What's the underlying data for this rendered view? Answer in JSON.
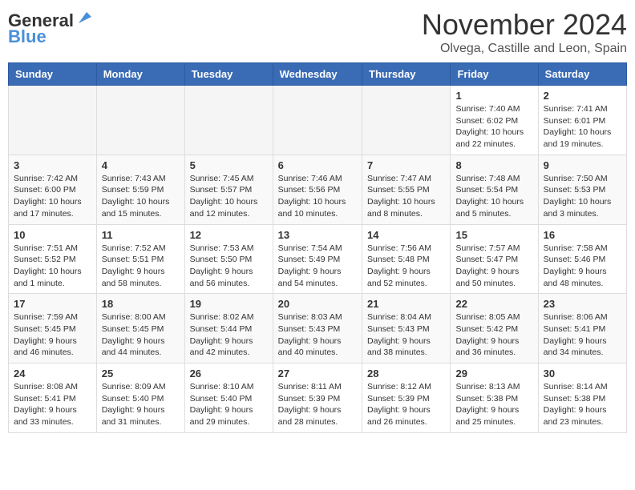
{
  "logo": {
    "line1": "General",
    "line2": "Blue"
  },
  "title": "November 2024",
  "location": "Olvega, Castille and Leon, Spain",
  "headers": [
    "Sunday",
    "Monday",
    "Tuesday",
    "Wednesday",
    "Thursday",
    "Friday",
    "Saturday"
  ],
  "weeks": [
    [
      {
        "day": "",
        "info": ""
      },
      {
        "day": "",
        "info": ""
      },
      {
        "day": "",
        "info": ""
      },
      {
        "day": "",
        "info": ""
      },
      {
        "day": "",
        "info": ""
      },
      {
        "day": "1",
        "info": "Sunrise: 7:40 AM\nSunset: 6:02 PM\nDaylight: 10 hours and 22 minutes."
      },
      {
        "day": "2",
        "info": "Sunrise: 7:41 AM\nSunset: 6:01 PM\nDaylight: 10 hours and 19 minutes."
      }
    ],
    [
      {
        "day": "3",
        "info": "Sunrise: 7:42 AM\nSunset: 6:00 PM\nDaylight: 10 hours and 17 minutes."
      },
      {
        "day": "4",
        "info": "Sunrise: 7:43 AM\nSunset: 5:59 PM\nDaylight: 10 hours and 15 minutes."
      },
      {
        "day": "5",
        "info": "Sunrise: 7:45 AM\nSunset: 5:57 PM\nDaylight: 10 hours and 12 minutes."
      },
      {
        "day": "6",
        "info": "Sunrise: 7:46 AM\nSunset: 5:56 PM\nDaylight: 10 hours and 10 minutes."
      },
      {
        "day": "7",
        "info": "Sunrise: 7:47 AM\nSunset: 5:55 PM\nDaylight: 10 hours and 8 minutes."
      },
      {
        "day": "8",
        "info": "Sunrise: 7:48 AM\nSunset: 5:54 PM\nDaylight: 10 hours and 5 minutes."
      },
      {
        "day": "9",
        "info": "Sunrise: 7:50 AM\nSunset: 5:53 PM\nDaylight: 10 hours and 3 minutes."
      }
    ],
    [
      {
        "day": "10",
        "info": "Sunrise: 7:51 AM\nSunset: 5:52 PM\nDaylight: 10 hours and 1 minute."
      },
      {
        "day": "11",
        "info": "Sunrise: 7:52 AM\nSunset: 5:51 PM\nDaylight: 9 hours and 58 minutes."
      },
      {
        "day": "12",
        "info": "Sunrise: 7:53 AM\nSunset: 5:50 PM\nDaylight: 9 hours and 56 minutes."
      },
      {
        "day": "13",
        "info": "Sunrise: 7:54 AM\nSunset: 5:49 PM\nDaylight: 9 hours and 54 minutes."
      },
      {
        "day": "14",
        "info": "Sunrise: 7:56 AM\nSunset: 5:48 PM\nDaylight: 9 hours and 52 minutes."
      },
      {
        "day": "15",
        "info": "Sunrise: 7:57 AM\nSunset: 5:47 PM\nDaylight: 9 hours and 50 minutes."
      },
      {
        "day": "16",
        "info": "Sunrise: 7:58 AM\nSunset: 5:46 PM\nDaylight: 9 hours and 48 minutes."
      }
    ],
    [
      {
        "day": "17",
        "info": "Sunrise: 7:59 AM\nSunset: 5:45 PM\nDaylight: 9 hours and 46 minutes."
      },
      {
        "day": "18",
        "info": "Sunrise: 8:00 AM\nSunset: 5:45 PM\nDaylight: 9 hours and 44 minutes."
      },
      {
        "day": "19",
        "info": "Sunrise: 8:02 AM\nSunset: 5:44 PM\nDaylight: 9 hours and 42 minutes."
      },
      {
        "day": "20",
        "info": "Sunrise: 8:03 AM\nSunset: 5:43 PM\nDaylight: 9 hours and 40 minutes."
      },
      {
        "day": "21",
        "info": "Sunrise: 8:04 AM\nSunset: 5:43 PM\nDaylight: 9 hours and 38 minutes."
      },
      {
        "day": "22",
        "info": "Sunrise: 8:05 AM\nSunset: 5:42 PM\nDaylight: 9 hours and 36 minutes."
      },
      {
        "day": "23",
        "info": "Sunrise: 8:06 AM\nSunset: 5:41 PM\nDaylight: 9 hours and 34 minutes."
      }
    ],
    [
      {
        "day": "24",
        "info": "Sunrise: 8:08 AM\nSunset: 5:41 PM\nDaylight: 9 hours and 33 minutes."
      },
      {
        "day": "25",
        "info": "Sunrise: 8:09 AM\nSunset: 5:40 PM\nDaylight: 9 hours and 31 minutes."
      },
      {
        "day": "26",
        "info": "Sunrise: 8:10 AM\nSunset: 5:40 PM\nDaylight: 9 hours and 29 minutes."
      },
      {
        "day": "27",
        "info": "Sunrise: 8:11 AM\nSunset: 5:39 PM\nDaylight: 9 hours and 28 minutes."
      },
      {
        "day": "28",
        "info": "Sunrise: 8:12 AM\nSunset: 5:39 PM\nDaylight: 9 hours and 26 minutes."
      },
      {
        "day": "29",
        "info": "Sunrise: 8:13 AM\nSunset: 5:38 PM\nDaylight: 9 hours and 25 minutes."
      },
      {
        "day": "30",
        "info": "Sunrise: 8:14 AM\nSunset: 5:38 PM\nDaylight: 9 hours and 23 minutes."
      }
    ]
  ]
}
